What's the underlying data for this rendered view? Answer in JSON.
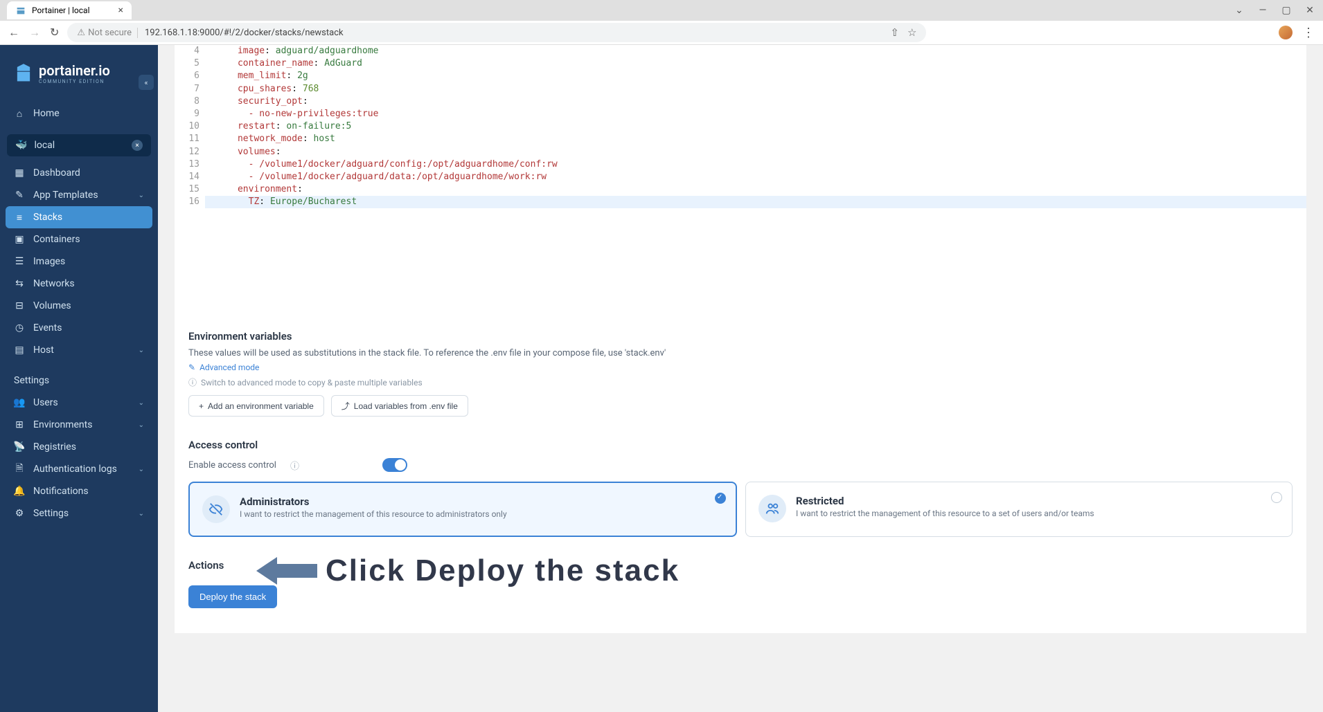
{
  "browser": {
    "tab_title": "Portainer | local",
    "not_secure": "Not secure",
    "url": "192.168.1.18:9000/#!/2/docker/stacks/newstack"
  },
  "sidebar": {
    "logo_title": "portainer.io",
    "logo_sub": "COMMUNITY EDITION",
    "home": "Home",
    "env_name": "local",
    "items": [
      "Dashboard",
      "App Templates",
      "Stacks",
      "Containers",
      "Images",
      "Networks",
      "Volumes",
      "Events",
      "Host"
    ],
    "settings_label": "Settings",
    "settings_items": [
      "Users",
      "Environments",
      "Registries",
      "Authentication logs",
      "Notifications",
      "Settings"
    ]
  },
  "editor": {
    "lines": [
      {
        "n": 4,
        "indent": 6,
        "key": "image",
        "sep": ": ",
        "val": "adguard/adguardhome"
      },
      {
        "n": 5,
        "indent": 6,
        "key": "container_name",
        "sep": ": ",
        "val": "AdGuard"
      },
      {
        "n": 6,
        "indent": 6,
        "key": "mem_limit",
        "sep": ": ",
        "val": "2g"
      },
      {
        "n": 7,
        "indent": 6,
        "key": "cpu_shares",
        "sep": ": ",
        "val": "768"
      },
      {
        "n": 8,
        "indent": 6,
        "key": "security_opt",
        "sep": ":",
        "val": ""
      },
      {
        "n": 9,
        "indent": 8,
        "key": "- no-new-privileges:true",
        "sep": "",
        "val": ""
      },
      {
        "n": 10,
        "indent": 6,
        "key": "restart",
        "sep": ": ",
        "val": "on-failure:5"
      },
      {
        "n": 11,
        "indent": 6,
        "key": "network_mode",
        "sep": ": ",
        "val": "host"
      },
      {
        "n": 12,
        "indent": 6,
        "key": "volumes",
        "sep": ":",
        "val": ""
      },
      {
        "n": 13,
        "indent": 8,
        "key": "- /volume1/docker/adguard/config:/opt/adguardhome/conf:rw",
        "sep": "",
        "val": ""
      },
      {
        "n": 14,
        "indent": 8,
        "key": "- /volume1/docker/adguard/data:/opt/adguardhome/work:rw",
        "sep": "",
        "val": ""
      },
      {
        "n": 15,
        "indent": 6,
        "key": "environment",
        "sep": ":",
        "val": ""
      },
      {
        "n": 16,
        "indent": 8,
        "key": "TZ",
        "sep": ": ",
        "val": "Europe/Bucharest",
        "highlight": true
      }
    ]
  },
  "envvars": {
    "title": "Environment variables",
    "desc": "These values will be used as substitutions in the stack file. To reference the .env file in your compose file, use 'stack.env'",
    "advanced": "Advanced mode",
    "switch_note": "Switch to advanced mode to copy & paste multiple variables",
    "add_btn": "Add an environment variable",
    "load_btn": "Load variables from .env file"
  },
  "access": {
    "title": "Access control",
    "enable_label": "Enable access control",
    "cards": [
      {
        "title": "Administrators",
        "desc": "I want to restrict the management of this resource to administrators only",
        "selected": true
      },
      {
        "title": "Restricted",
        "desc": "I want to restrict the management of this resource to a set of users and/or teams",
        "selected": false
      }
    ]
  },
  "actions": {
    "title": "Actions",
    "deploy": "Deploy the stack"
  },
  "annotation": "Click Deploy the stack"
}
